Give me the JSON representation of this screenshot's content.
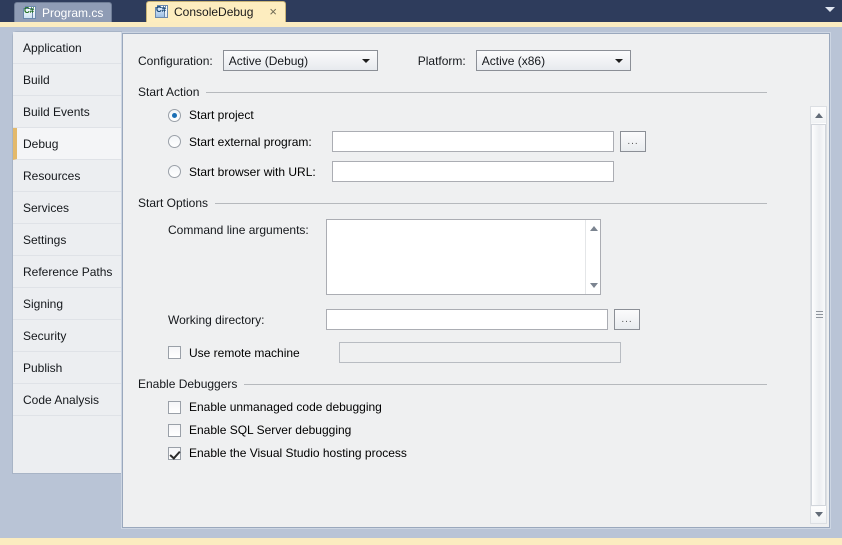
{
  "window": {
    "titlebar_dropdown_icon": "chevron-down-icon"
  },
  "tabs": [
    {
      "label": "Program.cs",
      "icon": "csharp-file-icon",
      "active": false,
      "closable": false
    },
    {
      "label": "ConsoleDebug",
      "icon": "csharp-project-icon",
      "active": true,
      "closable": true,
      "close_glyph": "×"
    }
  ],
  "sidebar": {
    "items": [
      {
        "label": "Application",
        "selected": false
      },
      {
        "label": "Build",
        "selected": false
      },
      {
        "label": "Build Events",
        "selected": false
      },
      {
        "label": "Debug",
        "selected": true
      },
      {
        "label": "Resources",
        "selected": false
      },
      {
        "label": "Services",
        "selected": false
      },
      {
        "label": "Settings",
        "selected": false
      },
      {
        "label": "Reference Paths",
        "selected": false
      },
      {
        "label": "Signing",
        "selected": false
      },
      {
        "label": "Security",
        "selected": false
      },
      {
        "label": "Publish",
        "selected": false
      },
      {
        "label": "Code Analysis",
        "selected": false
      }
    ]
  },
  "toolbar": {
    "configuration_label": "Configuration:",
    "configuration_value": "Active (Debug)",
    "platform_label": "Platform:",
    "platform_value": "Active (x86)"
  },
  "start_action": {
    "group_title": "Start Action",
    "options": [
      {
        "label": "Start project",
        "selected": true,
        "has_field": false
      },
      {
        "label": "Start external program:",
        "selected": false,
        "has_field": true,
        "value": "",
        "has_browse": true
      },
      {
        "label": "Start browser with URL:",
        "selected": false,
        "has_field": true,
        "value": "",
        "has_browse": false
      }
    ],
    "browse_label": "..."
  },
  "start_options": {
    "group_title": "Start Options",
    "command_line_label": "Command line arguments:",
    "command_line_value": "",
    "working_directory_label": "Working directory:",
    "working_directory_value": "",
    "browse_label": "...",
    "use_remote_machine_label": "Use remote machine",
    "use_remote_machine_checked": false,
    "remote_machine_value": ""
  },
  "enable_debuggers": {
    "group_title": "Enable Debuggers",
    "items": [
      {
        "label": "Enable unmanaged code debugging",
        "checked": false
      },
      {
        "label": "Enable SQL Server debugging",
        "checked": false
      },
      {
        "label": "Enable the Visual Studio hosting process",
        "checked": true
      }
    ]
  },
  "scrollbar": {
    "up_icon": "triangle-up-icon",
    "down_icon": "triangle-down-icon",
    "grip_icon": "grip-lines-icon"
  },
  "colors": {
    "titlebar": "#2e3c5c",
    "active_tab": "#fdedbf",
    "inactive_tab": "#8f9cb5",
    "desktop": "#b9c4d6",
    "panel": "#eff0f1",
    "selection_accent": "#e3b96b",
    "radio_dot": "#1b6fb5"
  }
}
